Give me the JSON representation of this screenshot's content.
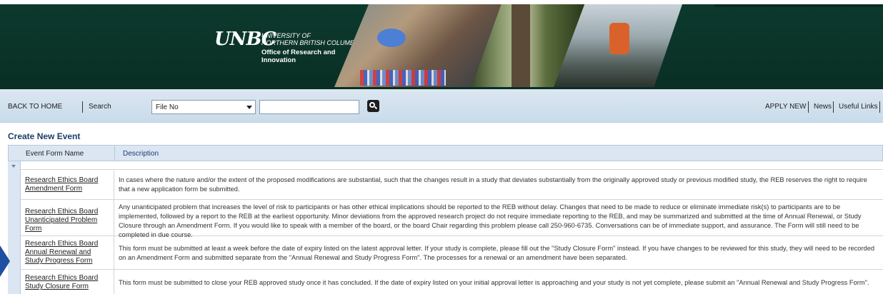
{
  "banner": {
    "logo_mark": "UNBC",
    "university_line1": "UNIVERSITY OF",
    "university_line2": "NORTHERN BRITISH COLUMBIA",
    "office_line1": "Office of Research and",
    "office_line2": "Innovation"
  },
  "nav": {
    "back_home": "BACK TO HOME",
    "search_label": "Search",
    "search_select_value": "File No",
    "search_input_value": "",
    "apply_new": "APPLY NEW",
    "news": "News",
    "useful_links": "Useful Links"
  },
  "section_title": "Create New Event",
  "table": {
    "col_event": "Event Form Name",
    "col_desc": "Description",
    "rows": [
      {
        "name": "Research Ethics Board Amendment Form",
        "description": "In cases where the nature and/or the extent of the proposed modifications are substantial, such that the changes result in a study that deviates substantially from the originally approved study or previous modified study, the REB reserves the right to require that a new application form be submitted."
      },
      {
        "name": "Research Ethics Board Unanticipated Problem Form",
        "description": "Any unanticipated problem that increases the level of risk to participants or has other ethical implications should be reported to the REB without delay. Changes that need to be made to reduce or eliminate immediate risk(s) to participants are to be implemented, followed by a report to the REB at the earliest opportunity. Minor deviations from the approved research project do not require immediate reporting to the REB, and may be summarized and submitted at the time of Annual Renewal, or Study Closure through an Amendment Form. If you would like to speak with a member of the board, or the board Chair regarding this problem please call 250-960-6735. Conversations can be of immediate support, and assurance. The Form will still need to be completed in due course."
      },
      {
        "name": "Research Ethics Board Annual Renewal and Study Progress Form",
        "description": "This form must be submitted at least a week before the date of expiry listed on the latest approval letter. If your study is complete, please fill out the \"Study Closure Form\" instead. If you have changes to be reviewed for this study, they will need to be recorded on an Amendment Form and submitted separate from the \"Annual Renewal and Study Progress Form\". The processes for a renewal or an amendment have been separated."
      },
      {
        "name": "Research Ethics Board Study Closure Form",
        "description": "This form must be submitted to close your REB approved study once it has concluded. If the date of expiry listed on your initial approval letter is approaching and your study is not yet complete, please submit an \"Annual Renewal and Study Progress Form\"."
      }
    ]
  },
  "colors": {
    "banner_bg": "#0d3a2e",
    "nav_bg": "#d2e1ee",
    "title_color": "#1a3d6a",
    "pointer": "#1f4fa0"
  }
}
